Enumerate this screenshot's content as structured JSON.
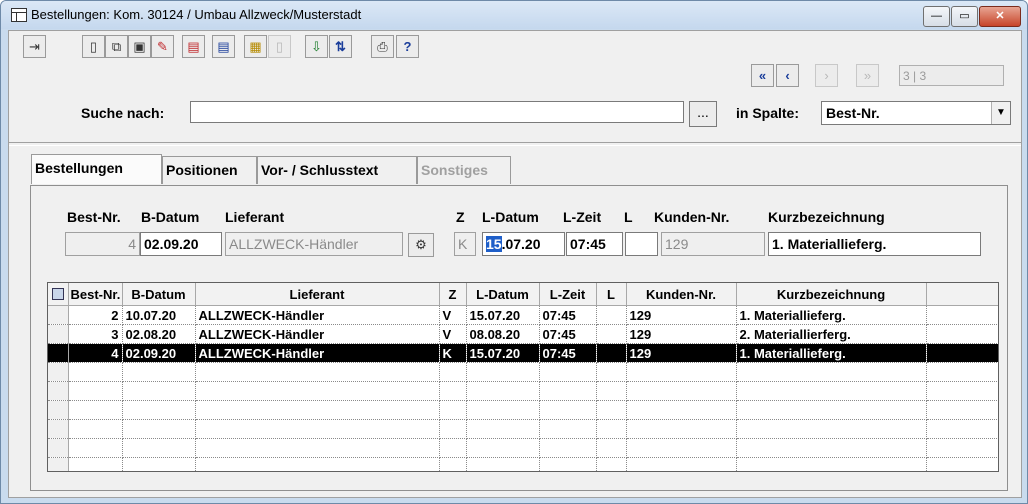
{
  "window": {
    "title": "Bestellungen: Kom. 30124 / Umbau Allzweck/Musterstadt",
    "controls": {
      "minimize": "—",
      "maximize": "▭",
      "close": "✕"
    }
  },
  "toolbar": {
    "icons": [
      "exit-icon",
      "new-document-icon",
      "copy-document-icon",
      "save-icon",
      "edit-icon",
      "document-red-icon",
      "document-blue-icon",
      "calendar-icon",
      "blank-icon",
      "export-excel-icon",
      "sort-az-icon",
      "print-icon",
      "help-icon",
      "first-record-icon",
      "previous-record-icon",
      "next-record-icon",
      "last-record-icon"
    ],
    "nav_counter": "3 | 3"
  },
  "search": {
    "label": "Suche nach:",
    "value": "",
    "dots_label": "...",
    "column_label": "in Spalte:",
    "column_value": "Best-Nr."
  },
  "tabs": [
    {
      "label": "Bestellungen",
      "active": true
    },
    {
      "label": "Positionen",
      "active": false
    },
    {
      "label": "Vor- / Schlusstext",
      "active": false
    },
    {
      "label": "Sonstiges",
      "active": false,
      "disabled": true
    }
  ],
  "form": {
    "headers": {
      "best_nr": "Best-Nr.",
      "b_datum": "B-Datum",
      "lieferant": "Lieferant",
      "z": "Z",
      "l_datum": "L-Datum",
      "l_zeit": "L-Zeit",
      "l": "L",
      "kunden_nr": "Kunden-Nr.",
      "kurzbezeichnung": "Kurzbezeichnung"
    },
    "values": {
      "best_nr": "4",
      "b_datum": "02.09.20",
      "lieferant": "ALLZWECK-Händler",
      "z": "K",
      "l_datum_sel": "15",
      "l_datum_rest": ".07.20",
      "l_zeit": "07:45",
      "l": "",
      "kunden_nr": "129",
      "kurzbezeichnung": "1. Materiallieferg."
    }
  },
  "grid": {
    "columns": [
      "Best-Nr.",
      "B-Datum",
      "Lieferant",
      "Z",
      "L-Datum",
      "L-Zeit",
      "L",
      "Kunden-Nr.",
      "Kurzbezeichnung"
    ],
    "rows": [
      {
        "best_nr": "2",
        "b_datum": "10.07.20",
        "lieferant": "ALLZWECK-Händler",
        "z": "V",
        "l_datum": "15.07.20",
        "l_zeit": "07:45",
        "l": "",
        "kunden_nr": "129",
        "kurzbezeichnung": "1. Materiallieferg."
      },
      {
        "best_nr": "3",
        "b_datum": "02.08.20",
        "lieferant": "ALLZWECK-Händler",
        "z": "V",
        "l_datum": "08.08.20",
        "l_zeit": "07:45",
        "l": "",
        "kunden_nr": "129",
        "kurzbezeichnung": "2. Materiallierferg."
      },
      {
        "best_nr": "4",
        "b_datum": "02.09.20",
        "lieferant": "ALLZWECK-Händler",
        "z": "K",
        "l_datum": "15.07.20",
        "l_zeit": "07:45",
        "l": "",
        "kunden_nr": "129",
        "kurzbezeichnung": "1. Materiallieferg."
      }
    ],
    "selected_row": 2
  }
}
